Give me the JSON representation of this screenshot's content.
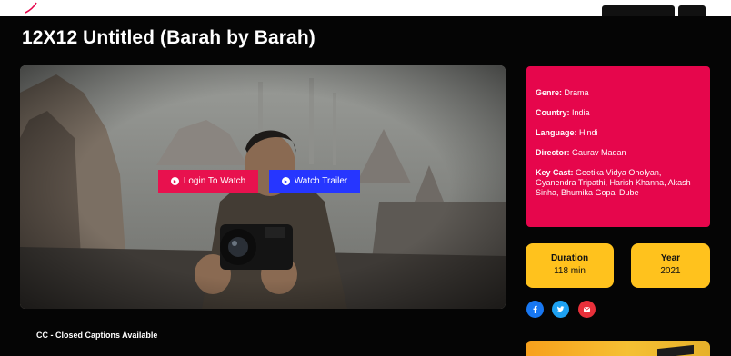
{
  "movie": {
    "title": "12X12 Untitled (Barah by Barah)"
  },
  "actions": {
    "login_label": "Login To Watch",
    "trailer_label": "Watch Trailer"
  },
  "captions_note": "CC - Closed Captions Available",
  "details": {
    "genre_label": "Genre:",
    "genre": "Drama",
    "country_label": "Country:",
    "country": "India",
    "language_label": "Language:",
    "language": "Hindi",
    "director_label": "Director:",
    "director": "Gaurav Madan",
    "cast_label": "Key Cast:",
    "cast": "Geetika Vidya Oholyan, Gyanendra Tripathi, Harish Khanna, Akash Sinha, Bhumika Gopal Dube"
  },
  "stats": {
    "duration_label": "Duration",
    "duration": "118 min",
    "year_label": "Year",
    "year": "2021"
  },
  "social": [
    "facebook-icon",
    "twitter-icon",
    "mail-icon"
  ],
  "colors": {
    "accent_red": "#e6064c",
    "login_button": "#e8114e",
    "trailer_button": "#2636ff",
    "stat_yellow": "#ffc21d"
  }
}
